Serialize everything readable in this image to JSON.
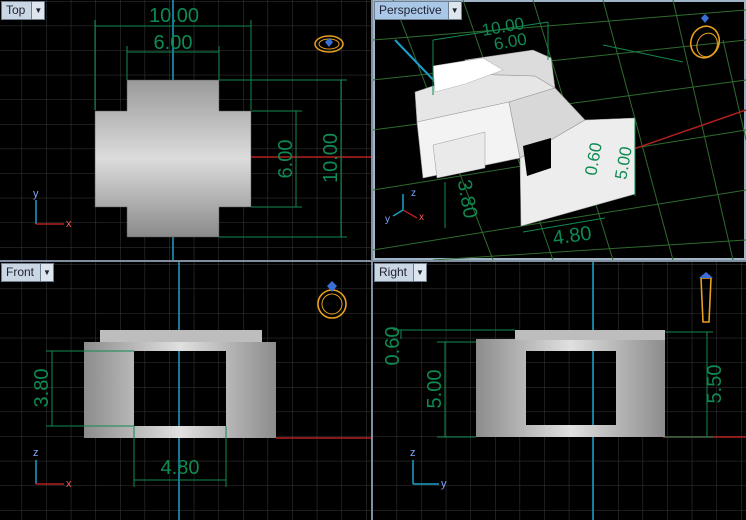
{
  "viewports": {
    "top": {
      "label": "Top"
    },
    "perspective": {
      "label": "Perspective"
    },
    "front": {
      "label": "Front"
    },
    "right": {
      "label": "Right"
    }
  },
  "dimensions": {
    "top": {
      "width_outer": "10.00",
      "width_inner": "6.00",
      "height_inner": "6.00",
      "height_outer": "10.00"
    },
    "perspective": {
      "d1": "10.00",
      "d2": "6.00",
      "height": "3.80",
      "width": "4.80",
      "depth": "0.60",
      "side": "5.00"
    },
    "front": {
      "height": "3.80",
      "width": "4.80"
    },
    "right": {
      "top": "0.60",
      "mid": "5.00",
      "total": "5.50"
    }
  },
  "axes": {
    "top": {
      "a": "y",
      "b": "x"
    },
    "perspective": {
      "a": "z",
      "b": "x",
      "c": "y"
    },
    "front": {
      "a": "z",
      "b": "x"
    },
    "right": {
      "a": "z",
      "b": "y"
    }
  },
  "dropdown_icon": "triangle-down",
  "colors": {
    "dimension": "#0f8a52",
    "grid": "#3a3a3a",
    "x_axis": "#b32020",
    "y_axis": "#1aa0c8",
    "ring": "#e8a020"
  }
}
